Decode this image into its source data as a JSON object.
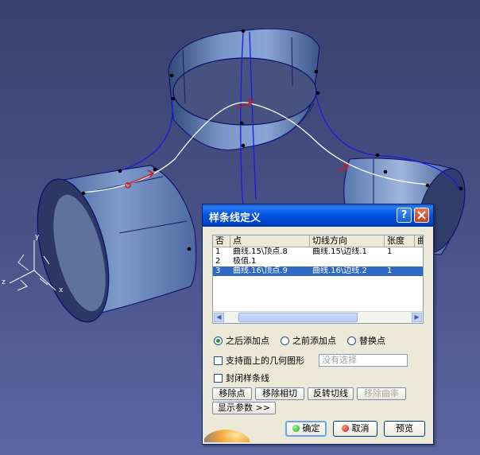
{
  "viewport": {
    "axis_labels": {
      "x": "x",
      "y": "y",
      "z": "z"
    }
  },
  "dialog": {
    "title": "样条线定义",
    "help_icon": "?",
    "close_icon": "close-icon",
    "list": {
      "columns": [
        "否",
        "点",
        "切线方向",
        "张度",
        "曲"
      ],
      "rows": [
        {
          "no": "1",
          "point": "曲线.15\\顶点.8",
          "tangent": "曲线.15\\边线.1",
          "tension": "1",
          "curvature": "",
          "selected": false
        },
        {
          "no": "2",
          "point": "极值.1",
          "tangent": "",
          "tension": "",
          "curvature": "",
          "selected": false
        },
        {
          "no": "3",
          "point": "曲线.16\\顶点.9",
          "tangent": "曲线.16\\边线.2",
          "tension": "1",
          "curvature": "",
          "selected": true
        }
      ]
    },
    "radios": [
      {
        "label": "之后添加点",
        "checked": true
      },
      {
        "label": "之前添加点",
        "checked": false
      },
      {
        "label": "替换点",
        "checked": false
      }
    ],
    "support_geometry": {
      "label": "支持面上的几何图形",
      "placeholder": "没有选择"
    },
    "close_spline": {
      "label": "封闭样条线"
    },
    "buttons": {
      "remove_point": "移除点",
      "remove_tangent": "移除相切",
      "reverse_tangent": "反转切线",
      "remove_curvature": "移除曲率",
      "show_params": "显示参数 >>"
    },
    "footer": {
      "ok": "确定",
      "cancel": "取消",
      "preview": "预览"
    }
  },
  "colors": {
    "selection": "#316ac5",
    "titlebar": "#0055e5",
    "viewport_bg": "#444e82"
  }
}
